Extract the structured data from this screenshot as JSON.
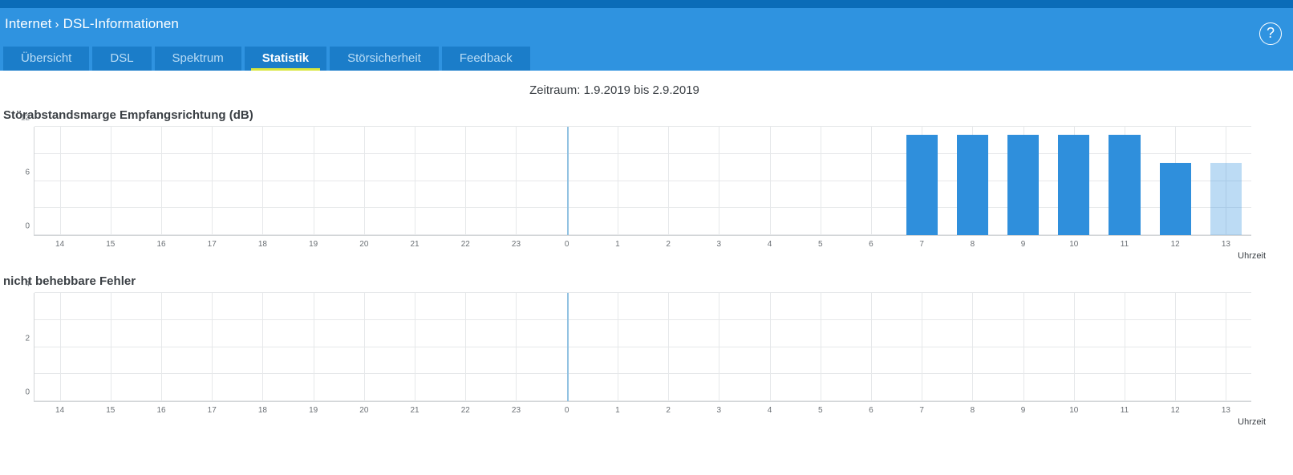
{
  "header": {
    "breadcrumb_root": "Internet",
    "breadcrumb_separator": "›",
    "breadcrumb_current": "DSL-Informationen",
    "help_icon": "question-mark-circle-icon",
    "help_glyph": "?"
  },
  "tabs": [
    {
      "label": "Übersicht",
      "active": false
    },
    {
      "label": "DSL",
      "active": false
    },
    {
      "label": "Spektrum",
      "active": false
    },
    {
      "label": "Statistik",
      "active": true
    },
    {
      "label": "Störsicherheit",
      "active": false
    },
    {
      "label": "Feedback",
      "active": false
    }
  ],
  "period": "Zeitraum: 1.9.2019 bis 2.9.2019",
  "colors": {
    "top_strip": "#0a6cb8",
    "header": "#2f93e0",
    "tab": "#1b7dc9",
    "tab_active_underline": "#d8e63c",
    "bar": "#2f8fdc",
    "bar_partial": "#bcdcf4",
    "gridline": "#e6e8ea",
    "axis": "#d3d6d8",
    "midnight_marker": "#92c2e2",
    "text": "#3a3f44"
  },
  "chart_data": [
    {
      "id": "snr-margin-downstream",
      "type": "bar",
      "title": "Störabstandsmarge Empfangsrichtung (dB)",
      "xlabel": "Uhrzeit",
      "ylabel": "",
      "ylim": [
        0,
        12
      ],
      "yticks": [
        0,
        6,
        12
      ],
      "ytick_labels": [
        "0",
        "6",
        "12"
      ],
      "y_gridlines": [
        0,
        3,
        6,
        9,
        12
      ],
      "grid": true,
      "categories": [
        "14",
        "15",
        "16",
        "17",
        "18",
        "19",
        "20",
        "21",
        "22",
        "23",
        "0",
        "1",
        "2",
        "3",
        "4",
        "5",
        "6",
        "7",
        "8",
        "9",
        "10",
        "11",
        "12",
        "13"
      ],
      "values": [
        null,
        null,
        null,
        null,
        null,
        null,
        null,
        null,
        null,
        null,
        null,
        null,
        null,
        null,
        null,
        null,
        null,
        11.1,
        11.1,
        11.1,
        11.1,
        11.1,
        8.0,
        8.0
      ],
      "partial_index": 23,
      "midnight_index": 10,
      "annotations": [
        "Senkrechte Markierung bei 0 Uhr (Tageswechsel)"
      ]
    },
    {
      "id": "uncorrectable-errors",
      "type": "bar",
      "title": "nicht behebbare Fehler",
      "xlabel": "Uhrzeit",
      "ylabel": "",
      "ylim": [
        0,
        4
      ],
      "yticks": [
        0,
        2,
        4
      ],
      "ytick_labels": [
        "0",
        "2",
        "4"
      ],
      "y_gridlines": [
        0,
        1,
        2,
        3,
        4
      ],
      "grid": true,
      "categories": [
        "14",
        "15",
        "16",
        "17",
        "18",
        "19",
        "20",
        "21",
        "22",
        "23",
        "0",
        "1",
        "2",
        "3",
        "4",
        "5",
        "6",
        "7",
        "8",
        "9",
        "10",
        "11",
        "12",
        "13"
      ],
      "values": [
        0,
        0,
        0,
        0,
        0,
        0,
        0,
        0,
        0,
        0,
        0,
        0,
        0,
        0,
        0,
        0,
        0,
        0,
        0,
        0,
        0,
        0,
        0,
        0
      ],
      "partial_index": 23,
      "midnight_index": 10,
      "annotations": [
        "Keine Fehler im dargestellten Zeitraum"
      ]
    }
  ]
}
